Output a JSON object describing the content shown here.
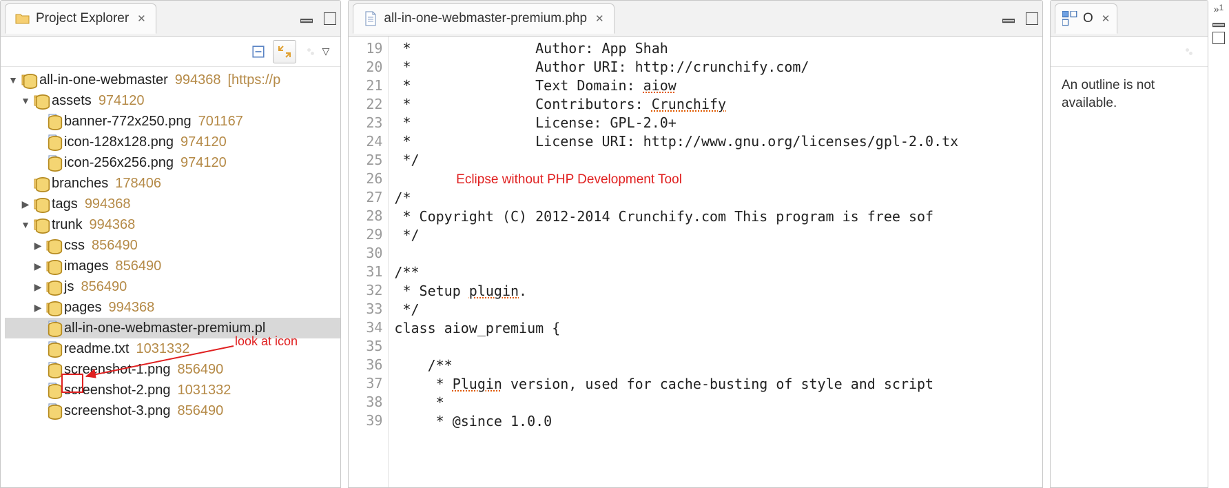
{
  "left": {
    "tab_title": "Project Explorer",
    "tree": {
      "project": {
        "name": "all-in-one-webmaster",
        "rev": "994368",
        "repo": "[https://p"
      },
      "assets": {
        "name": "assets",
        "rev": "974120"
      },
      "asset_files": [
        {
          "name": "banner-772x250.png",
          "rev": "701167"
        },
        {
          "name": "icon-128x128.png",
          "rev": "974120"
        },
        {
          "name": "icon-256x256.png",
          "rev": "974120"
        }
      ],
      "branches": {
        "name": "branches",
        "rev": "178406"
      },
      "tags": {
        "name": "tags",
        "rev": "994368"
      },
      "trunk": {
        "name": "trunk",
        "rev": "994368"
      },
      "trunk_dirs": [
        {
          "name": "css",
          "rev": "856490"
        },
        {
          "name": "images",
          "rev": "856490"
        },
        {
          "name": "js",
          "rev": "856490"
        },
        {
          "name": "pages",
          "rev": "994368"
        }
      ],
      "trunk_files": [
        {
          "name": "all-in-one-webmaster-premium.pl",
          "rev": ""
        },
        {
          "name": "readme.txt",
          "rev": "1031332"
        },
        {
          "name": "screenshot-1.png",
          "rev": "856490"
        },
        {
          "name": "screenshot-2.png",
          "rev": "1031332"
        },
        {
          "name": "screenshot-3.png",
          "rev": "856490"
        }
      ]
    },
    "annot": "look at icon"
  },
  "editor": {
    "tab_title": "all-in-one-webmaster-premium.php",
    "first_line": 19,
    "lines": [
      " *               Author: App Shah",
      " *               Author URI: http://crunchify.com/",
      " *               Text Domain: aiow",
      " *               Contributors: Crunchify",
      " *               License: GPL-2.0+",
      " *               License URI: http://www.gnu.org/licenses/gpl-2.0.tx",
      " */",
      "",
      "/*",
      " * Copyright (C) 2012-2014 Crunchify.com This program is free sof",
      " */",
      "",
      "/**",
      " * Setup plugin.",
      " */",
      "class aiow_premium {",
      "",
      "    /**",
      "     * Plugin version, used for cache-busting of style and script",
      "     *",
      "     * @since 1.0.0"
    ],
    "squiggles": {
      "21": [
        "aiow"
      ],
      "22": [
        "Crunchify"
      ],
      "32": [
        "plugin"
      ],
      "37": [
        "Plugin"
      ]
    },
    "annot": "Eclipse without PHP Development Tool"
  },
  "right": {
    "tab1": "O",
    "overflow_count": "1",
    "message": "An outline is not available."
  }
}
